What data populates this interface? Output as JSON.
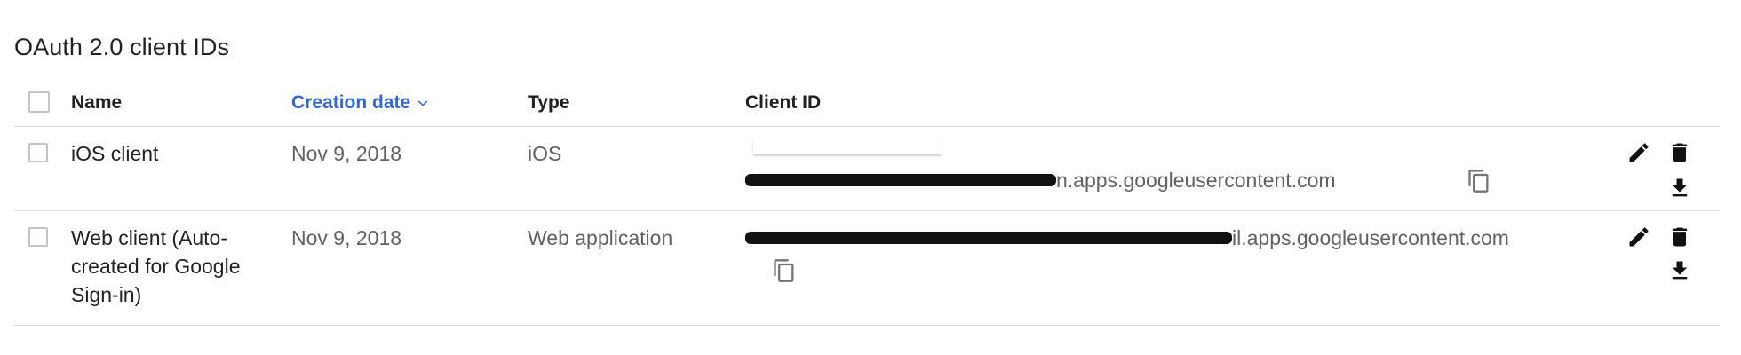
{
  "section": {
    "title": "OAuth 2.0 client IDs"
  },
  "table": {
    "headers": {
      "name": "Name",
      "creation_date": "Creation date",
      "type": "Type",
      "client_id": "Client ID"
    },
    "rows": [
      {
        "name": "iOS client",
        "date": "Nov 9, 2018",
        "type": "iOS",
        "client_id_suffix": "n.apps.googleusercontent.com"
      },
      {
        "name": "Web client (Auto-created for Google Sign-in)",
        "date": "Nov 9, 2018",
        "type": "Web application",
        "client_id_suffix": "il.apps.googleusercontent.com"
      }
    ]
  },
  "icons": {
    "sort": "chevron-down-icon",
    "copy": "copy-icon",
    "edit": "edit-pencil-icon",
    "delete": "trash-icon",
    "download": "download-icon"
  },
  "colors": {
    "accent": "#3367d6",
    "text": "#212121",
    "secondary_text": "#616161",
    "divider": "#e0e0e0"
  }
}
